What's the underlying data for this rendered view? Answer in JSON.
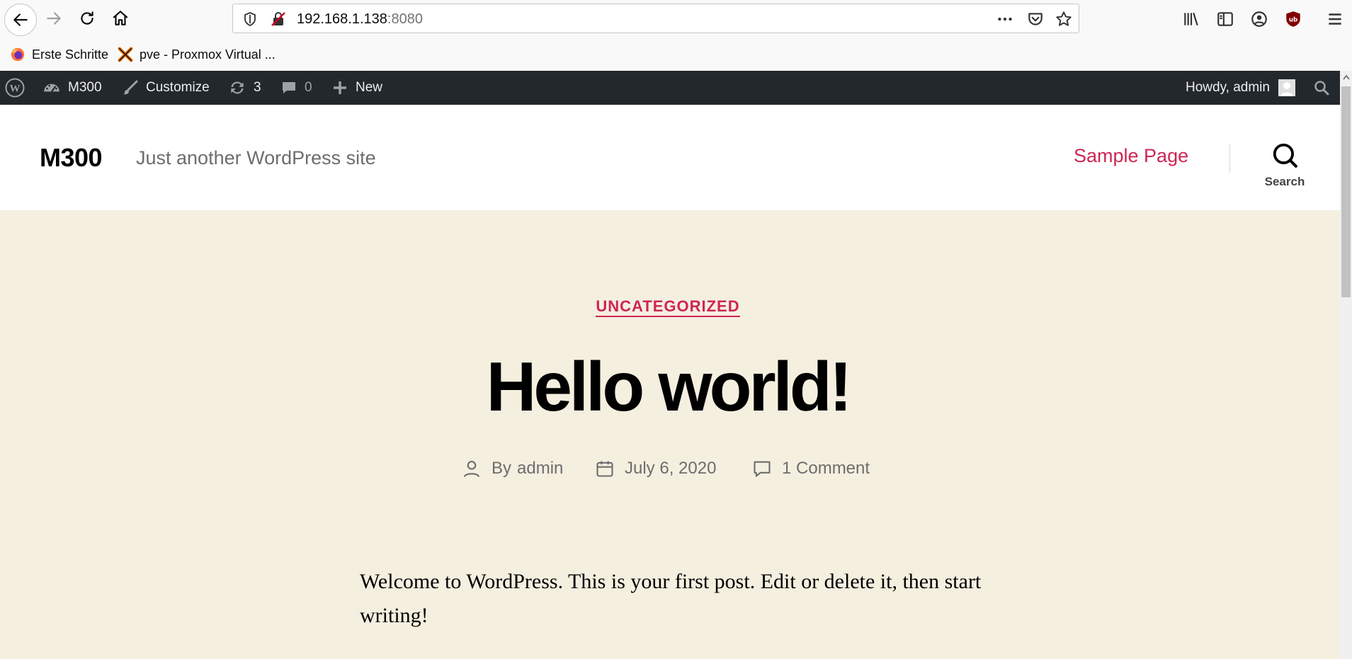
{
  "browser": {
    "url_host": "192.168.1.138",
    "url_port": ":8080",
    "bookmarks": [
      {
        "label": "Erste Schritte",
        "icon": "firefox-icon"
      },
      {
        "label": "pve - Proxmox Virtual ...",
        "icon": "proxmox-icon"
      }
    ]
  },
  "adminbar": {
    "site_name": "M300",
    "customize": "Customize",
    "updates_count": "3",
    "comments_count": "0",
    "new_label": "New",
    "howdy": "Howdy, admin"
  },
  "site": {
    "title": "M300",
    "description": "Just another WordPress site",
    "menu": [
      "Sample Page"
    ],
    "search_label": "Search"
  },
  "post": {
    "category": "UNCATEGORIZED",
    "title": "Hello world!",
    "author": "admin",
    "author_prefix": "By ",
    "date": "July 6, 2020",
    "comments": "1 Comment",
    "content": "Welcome to WordPress. This is your first post. Edit or delete it, then start writing!"
  },
  "colors": {
    "accent": "#cd2653",
    "adminbar_bg": "#23282d",
    "entry_bg": "#f5efe0"
  }
}
